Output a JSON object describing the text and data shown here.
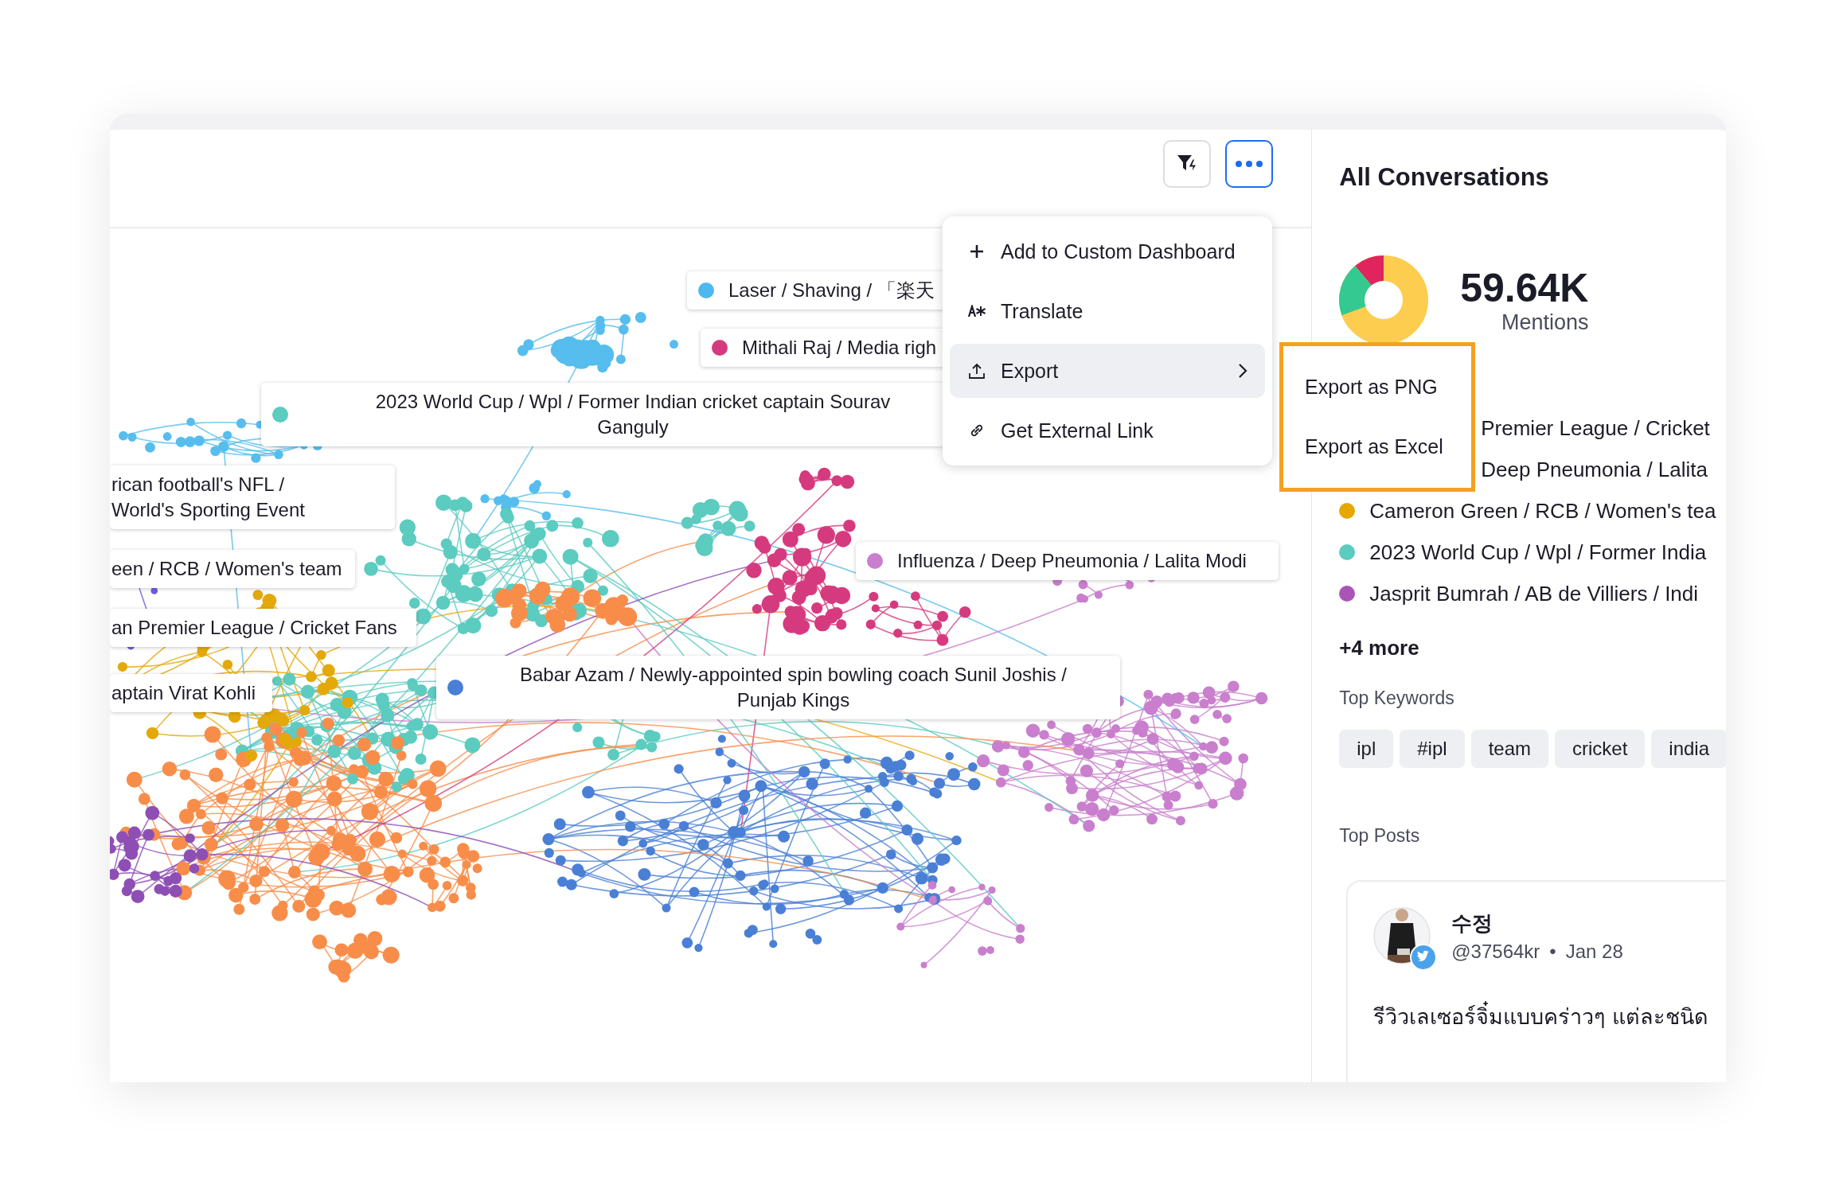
{
  "toolbar": {
    "more_active": true
  },
  "graph": {
    "labels": [
      {
        "text": "Laser / Shaving / 「楽天",
        "color": "#4db8ef"
      },
      {
        "text": "Mithali Raj / Media righ",
        "color": "#d63a7e"
      },
      {
        "text": "2023 World Cup / Wpl / Former Indian cricket captain Sourav Ganguly",
        "color": "#5ccbc0"
      },
      {
        "text": "rican football's NFL / World's Sporting Event"
      },
      {
        "text": "een / RCB / Women's team"
      },
      {
        "text": "an Premier League / Cricket Fans"
      },
      {
        "text": "aptain Virat Kohli"
      },
      {
        "text": "Influenza / Deep Pneumonia / Lalita Modi",
        "color": "#c97fcd"
      },
      {
        "text": "Babar Azam / Newly-appointed spin bowling coach Sunil Joshis / Punjab Kings",
        "color": "#4a7fd6"
      }
    ]
  },
  "menu": {
    "items": [
      {
        "kind": "add",
        "label": "Add to Custom Dashboard",
        "selected": false
      },
      {
        "kind": "translate",
        "label": "Translate",
        "selected": false
      },
      {
        "kind": "export",
        "label": "Export",
        "selected": true
      },
      {
        "kind": "link",
        "label": "Get External Link",
        "selected": false
      }
    ]
  },
  "submenu": {
    "items": [
      "Export as PNG",
      "Export as Excel"
    ]
  },
  "panel": {
    "title": "All Conversations",
    "total": "59.64K",
    "total_label": "Mentions",
    "legend": [
      {
        "text": "Premier League / Cricket"
      },
      {
        "text": "Deep Pneumonia / Lalita"
      },
      {
        "text": "Cameron Green / RCB / Women's tea",
        "color": "#e6a800"
      },
      {
        "text": "2023 World Cup / Wpl / Former India",
        "color": "#5ccbc0"
      },
      {
        "text": "Jasprit Bumrah / AB de Villiers / Indi",
        "color": "#a855b5"
      }
    ],
    "more": "+4 more",
    "keywords_title": "Top Keywords",
    "keywords": [
      "ipl",
      "#ipl",
      "team",
      "cricket",
      "india"
    ],
    "posts_title": "Top Posts",
    "posts": [
      {
        "name": "수정",
        "handle": "@37564kr",
        "separator": "•",
        "date": "Jan 28",
        "text": "รีวิวเลเซอร์จิ๋มแบบคร่าวๆ แต่ละชนิด"
      }
    ]
  }
}
